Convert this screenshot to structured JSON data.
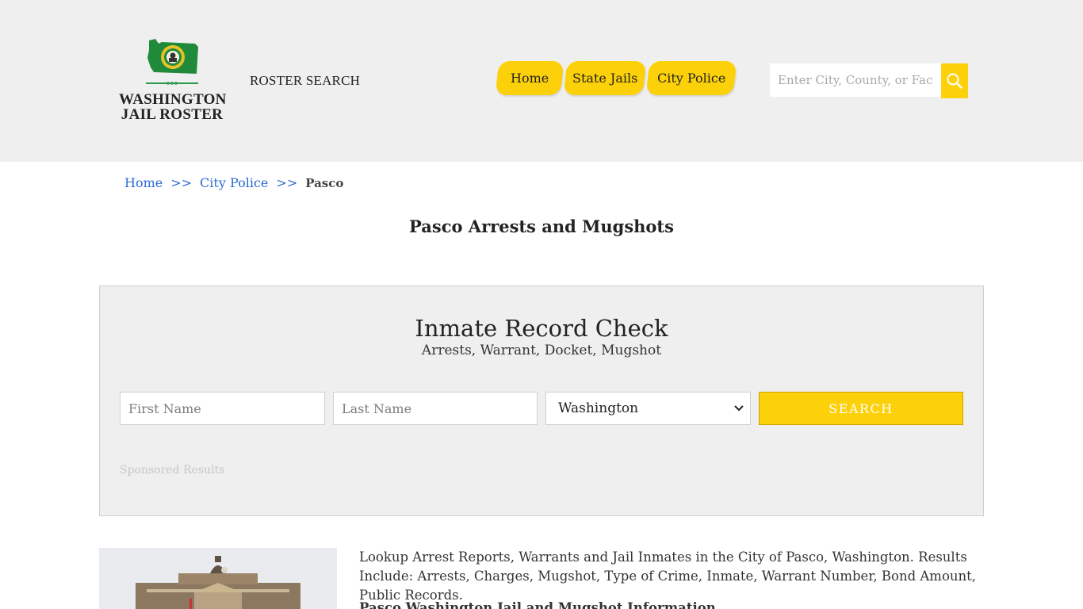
{
  "header": {
    "logo_line1": "WASHINGTON",
    "logo_line2": "JAIL ROSTER",
    "roster_search": "ROSTER SEARCH",
    "nav": [
      {
        "label": "Home"
      },
      {
        "label": "State Jails"
      },
      {
        "label": "City Police"
      }
    ],
    "search_placeholder": "Enter City, County, or Facility"
  },
  "breadcrumb": {
    "items": [
      "Home",
      "City Police",
      "Pasco"
    ],
    "separator": ">>"
  },
  "page_title": "Pasco Arrests and Mugshots",
  "record_check": {
    "title": "Inmate Record Check",
    "subtitle": "Arrests, Warrant, Docket, Mugshot",
    "first_name_placeholder": "First Name",
    "last_name_placeholder": "Last Name",
    "state_selected": "Washington",
    "search_label": "SEARCH",
    "sponsored": "Sponsored Results"
  },
  "content": {
    "intro": "Lookup Arrest Reports, Warrants and Jail Inmates in the City of Pasco, Washington. Results Include: Arrests, Charges, Mugshot, Type of Crime, Inmate, Warrant Number, Bond Amount, Public Records.",
    "section_heading": "Pasco Washington Jail and Mugshot Information"
  },
  "colors": {
    "accent": "#fdd10a",
    "header_bg": "#efefef",
    "link": "#2e6bd3"
  }
}
